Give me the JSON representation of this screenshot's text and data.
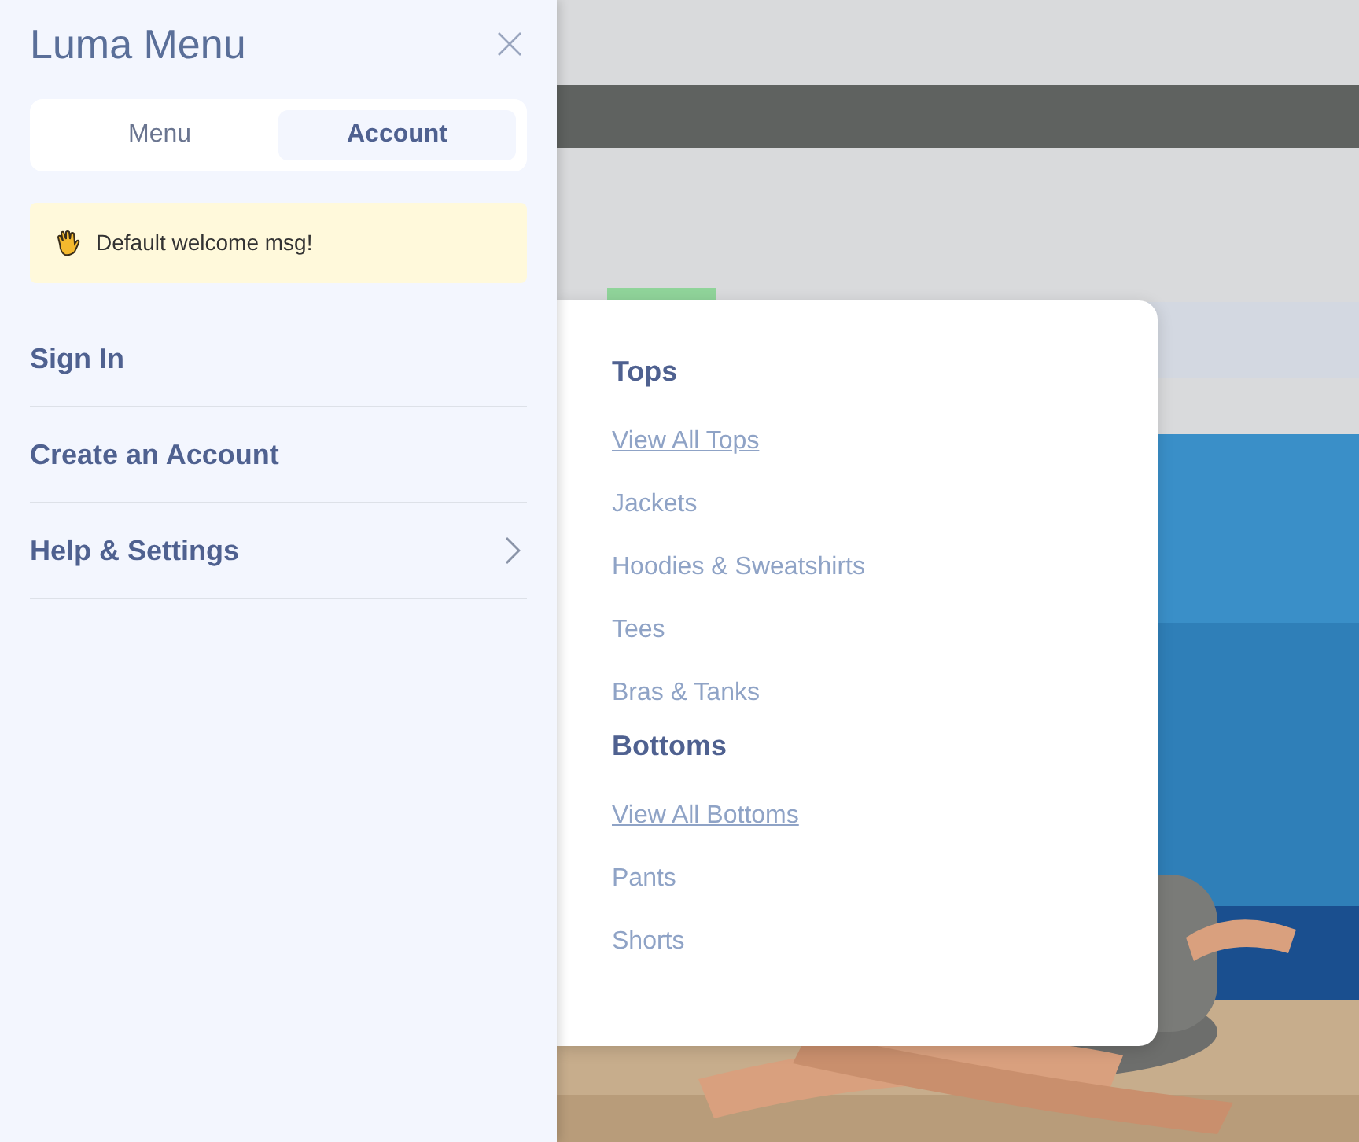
{
  "panel": {
    "title": "Luma Menu",
    "tabs": [
      {
        "label": "Menu",
        "selected": false
      },
      {
        "label": "Account",
        "selected": true
      }
    ],
    "welcome": "Default welcome msg!",
    "links": [
      {
        "label": "Sign In",
        "has_submenu": false
      },
      {
        "label": "Create an Account",
        "has_submenu": false
      },
      {
        "label": "Help & Settings",
        "has_submenu": true
      }
    ]
  },
  "dropdown": {
    "groups": [
      {
        "heading": "Tops",
        "items": [
          {
            "label": "View All Tops",
            "kind": "view_all"
          },
          {
            "label": "Jackets",
            "kind": "link"
          },
          {
            "label": "Hoodies & Sweatshirts",
            "kind": "link"
          },
          {
            "label": "Tees",
            "kind": "link"
          },
          {
            "label": "Bras & Tanks",
            "kind": "link"
          }
        ]
      },
      {
        "heading": "Bottoms",
        "items": [
          {
            "label": "View All Bottoms",
            "kind": "view_all"
          },
          {
            "label": "Pants",
            "kind": "link"
          },
          {
            "label": "Shorts",
            "kind": "link"
          }
        ]
      }
    ]
  }
}
